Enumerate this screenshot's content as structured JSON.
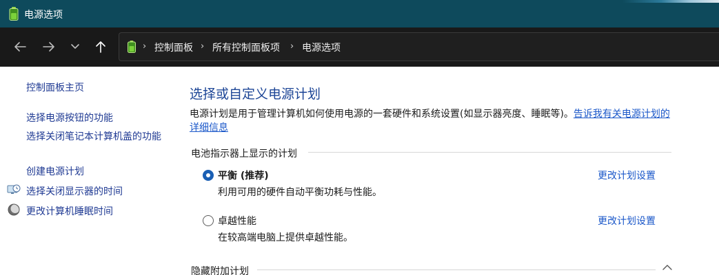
{
  "window": {
    "title": "电源选项",
    "app_icon": "battery-icon"
  },
  "nav": {
    "back_icon": "arrow-left-icon",
    "forward_icon": "arrow-right-icon",
    "recent_icon": "chevron-down-icon",
    "up_icon": "arrow-up-icon",
    "address_icon": "battery-icon",
    "breadcrumbs": [
      "控制面板",
      "所有控制面板项",
      "电源选项"
    ],
    "separator": "›"
  },
  "sidebar": {
    "home_link": "控制面板主页",
    "links": [
      {
        "label": "选择电源按钮的功能"
      },
      {
        "label": "选择关闭笔记本计算机盖的功能"
      },
      {
        "label": "创建电源计划"
      },
      {
        "label": "选择关闭显示器的时间",
        "icon": "monitor-clock-icon"
      },
      {
        "label": "更改计算机睡眠时间",
        "icon": "moon-icon"
      }
    ]
  },
  "main": {
    "title": "选择或自定义电源计划",
    "description": "电源计划是用于管理计算机如何使用电源的一套硬件和系统设置(如显示器亮度、睡眠等)。",
    "description_link": "告诉我有关电源计划的详细信息",
    "battery_section_label": "电池指示器上显示的计划",
    "hidden_section_label": "隐藏附加计划",
    "plans": [
      {
        "name": "平衡 (推荐)",
        "description": "利用可用的硬件自动平衡功耗与性能。",
        "selected": true,
        "link": "更改计划设置"
      },
      {
        "name": "卓越性能",
        "description": "在较高端电脑上提供卓越性能。",
        "selected": false,
        "link": "更改计划设置"
      }
    ]
  },
  "colors": {
    "titlebar": "#0e4a5c",
    "navbar": "#191919",
    "link": "#1a57c9",
    "heading": "#1c4596",
    "radio_selected": "#1a5fb4"
  }
}
